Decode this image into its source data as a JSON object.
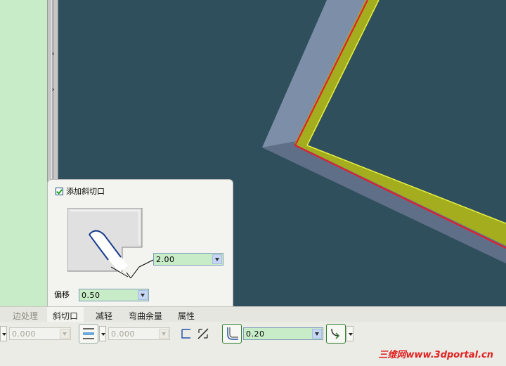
{
  "relief_panel": {
    "add_relief_label": "添加斜切口",
    "add_relief_checked": true,
    "width_value": "2.00",
    "offset_label": "偏移",
    "offset_value": "0.50"
  },
  "tabs": [
    {
      "label": "边处理",
      "state": "inactive"
    },
    {
      "label": "斜切口",
      "state": "active"
    },
    {
      "label": "减轻",
      "state": "normal"
    },
    {
      "label": "弯曲余量",
      "state": "normal"
    },
    {
      "label": "属性",
      "state": "normal"
    }
  ],
  "dashboard": {
    "thickness_value": "0.000",
    "gap_value": "0.000",
    "radius_value": "0.20"
  },
  "watermark": "三维网www.3dportal.cn",
  "colors": {
    "viewport_bg": "#2f4f5c",
    "panel_bg": "#c8ecc8",
    "sheet_face": "#7d8fa8",
    "flange_yellow": "#a3ad1e",
    "edge_red": "#e02030"
  }
}
